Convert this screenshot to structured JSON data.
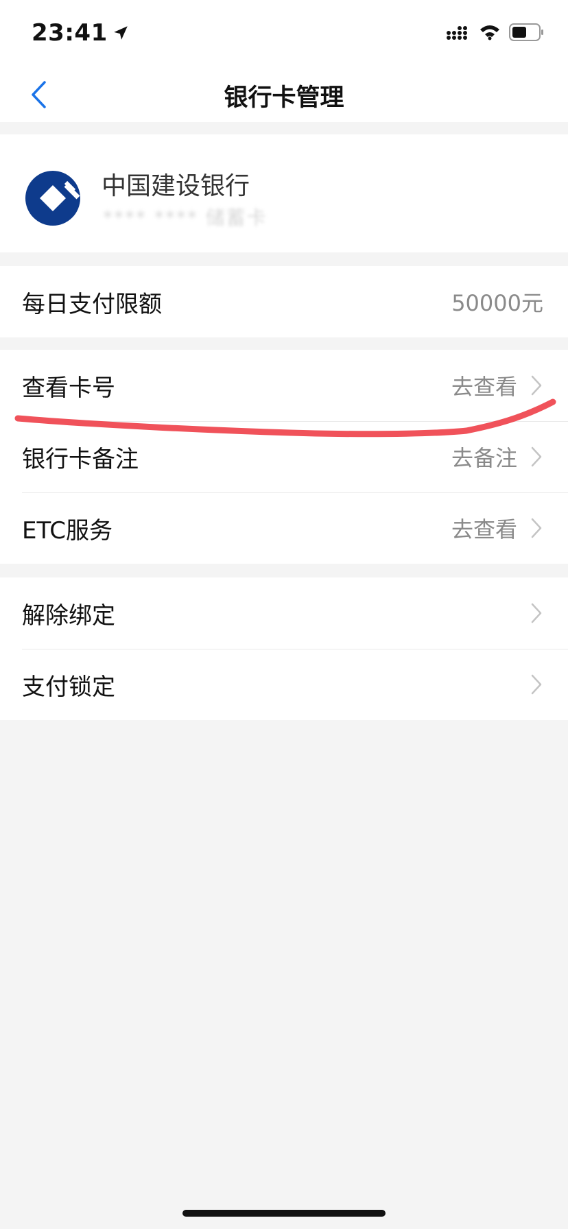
{
  "status_bar": {
    "time": "23:41",
    "icons": [
      "location-arrow-icon",
      "signal-icon",
      "wifi-icon",
      "battery-icon"
    ]
  },
  "nav": {
    "back_icon": "chevron-left-icon",
    "title": "银行卡管理"
  },
  "card": {
    "bank_name": "中国建设银行",
    "card_number": "**** ****  储蓄卡"
  },
  "limit_section": {
    "label": "每日支付限额",
    "value": "50000元"
  },
  "info_section": {
    "items": [
      {
        "label": "查看卡号",
        "action": "去查看"
      },
      {
        "label": "银行卡备注",
        "action": "去备注"
      },
      {
        "label": "ETC服务",
        "action": "去查看"
      }
    ]
  },
  "manage_section": {
    "items": [
      {
        "label": "解除绑定"
      },
      {
        "label": "支付锁定"
      }
    ]
  },
  "colors": {
    "accent": "#1a73e8",
    "bank_brand": "#0e3b8c",
    "annotation": "#f0525a",
    "secondary_text": "#8a8a8a",
    "background": "#f4f4f4"
  }
}
